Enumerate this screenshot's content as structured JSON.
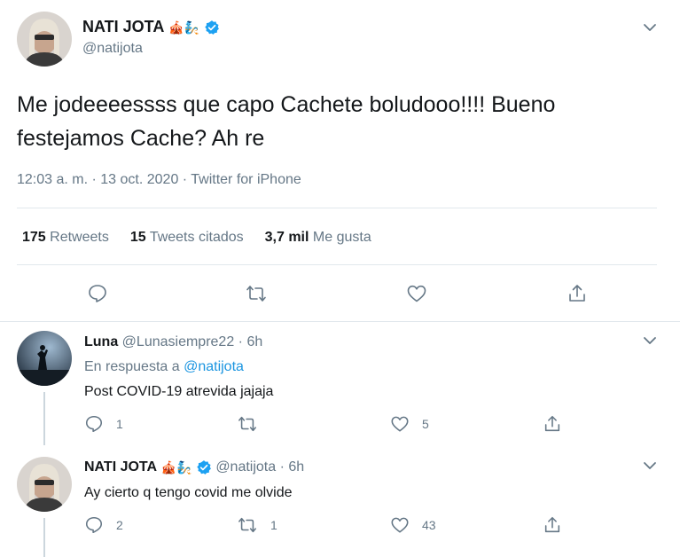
{
  "main_tweet": {
    "name": "NATI JOTA",
    "emojis": "🎪🧞",
    "handle": "@natijota",
    "text": "Me jodeeeessss que capo Cachete boludooo!!!! Bueno festejamos Cache? Ah re",
    "meta": "12:03 a. m. · 13 oct. 2020 · Twitter for iPhone",
    "stats": {
      "retweets_count": "175",
      "retweets_label": "Retweets",
      "quotes_count": "15",
      "quotes_label": "Tweets citados",
      "likes_count": "3,7 mil",
      "likes_label": "Me gusta"
    },
    "icons": [
      "reply-icon",
      "retweet-icon",
      "like-icon",
      "share-icon"
    ]
  },
  "replies": [
    {
      "name": "Luna",
      "handle": "@Lunasiempre22",
      "time": "· 6h",
      "reply_to_label": "En respuesta a",
      "reply_to_handle": "@natijota",
      "text": "Post COVID-19 atrevida jajaja",
      "reply_count": "1",
      "retweet_count": "",
      "like_count": "5"
    },
    {
      "name": "NATI JOTA",
      "emojis": "🎪🧞",
      "handle": "@natijota",
      "time": "· 6h",
      "text": "Ay cierto q tengo covid me olvide",
      "reply_count": "2",
      "retweet_count": "1",
      "like_count": "43"
    }
  ],
  "colors": {
    "link": "#1b95e0",
    "muted": "#657786",
    "verified": "#1da1f2",
    "divider": "#e1e8ed"
  }
}
